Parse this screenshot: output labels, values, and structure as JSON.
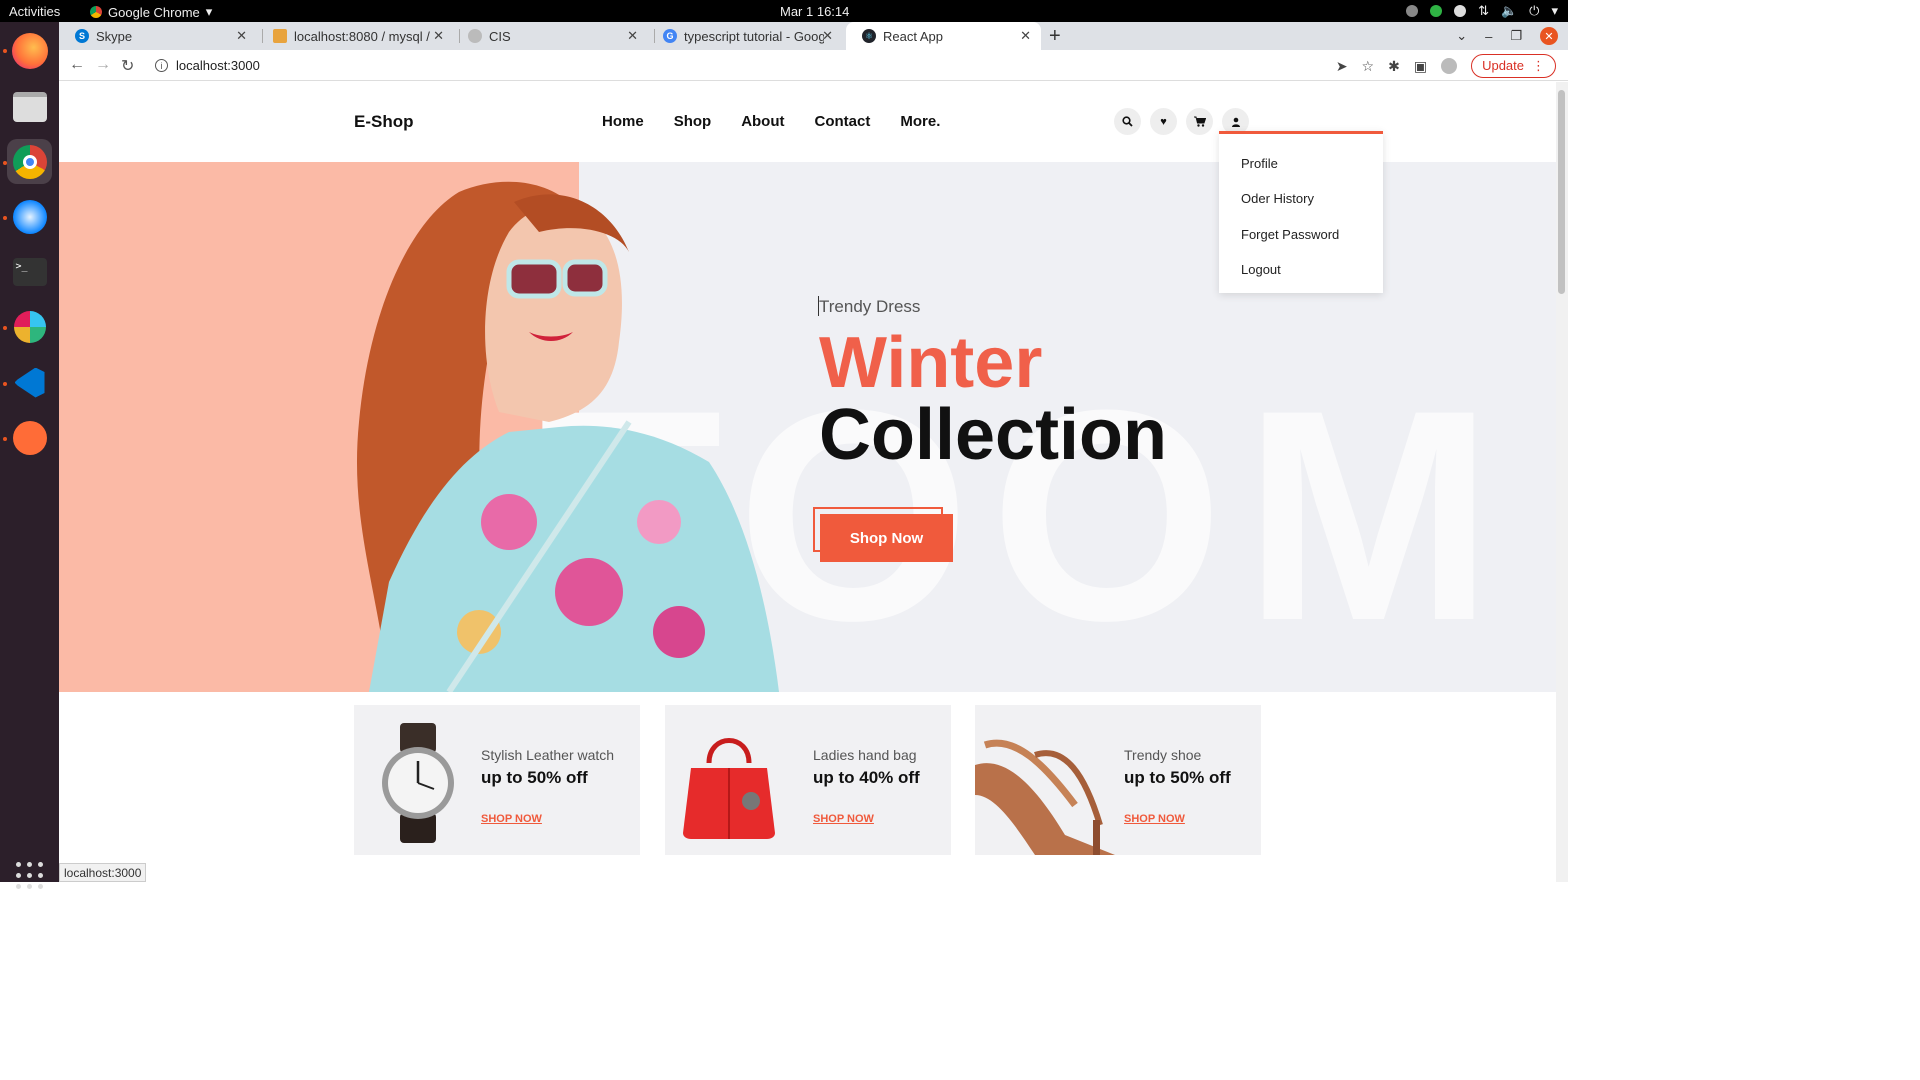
{
  "system": {
    "activities": "Activities",
    "app_menu": "Google Chrome",
    "clock": "Mar 1  16:14"
  },
  "tabs": [
    {
      "title": "Skype",
      "color": "#0078d4"
    },
    {
      "title": "localhost:8080 / mysql / n",
      "color": "#e8a33d"
    },
    {
      "title": "CIS",
      "color": "#888888"
    },
    {
      "title": "typescript tutorial - Goog",
      "color": "#4285f4"
    },
    {
      "title": "React App",
      "color": "#20232a"
    }
  ],
  "address_bar": {
    "url": "localhost:3000",
    "update_label": "Update"
  },
  "site": {
    "logo": "E-Shop",
    "nav": [
      "Home",
      "Shop",
      "About",
      "Contact",
      "More."
    ],
    "header_icons": [
      "search-icon",
      "heart-icon",
      "cart-icon",
      "user-icon"
    ],
    "accent": "#f05a3c"
  },
  "user_menu": {
    "items": [
      "Profile",
      "Oder History",
      "Forget Password",
      "Logout"
    ]
  },
  "hero": {
    "subtitle": "Trendy Dress",
    "title_line1": "Winter",
    "title_line2": "Collection",
    "button": "Shop Now",
    "background_text": "TOOM"
  },
  "promos": [
    {
      "title": "Stylish Leather watch",
      "offer": "up to 50% off",
      "link": "SHOP NOW",
      "icon": "watch-icon"
    },
    {
      "title": "Ladies hand bag",
      "offer": "up to 40% off",
      "link": "SHOP NOW",
      "icon": "handbag-icon"
    },
    {
      "title": "Trendy shoe",
      "offer": "up to 50% off",
      "link": "SHOP NOW",
      "icon": "shoe-icon"
    }
  ],
  "status_bar": {
    "url": "localhost:3000"
  }
}
